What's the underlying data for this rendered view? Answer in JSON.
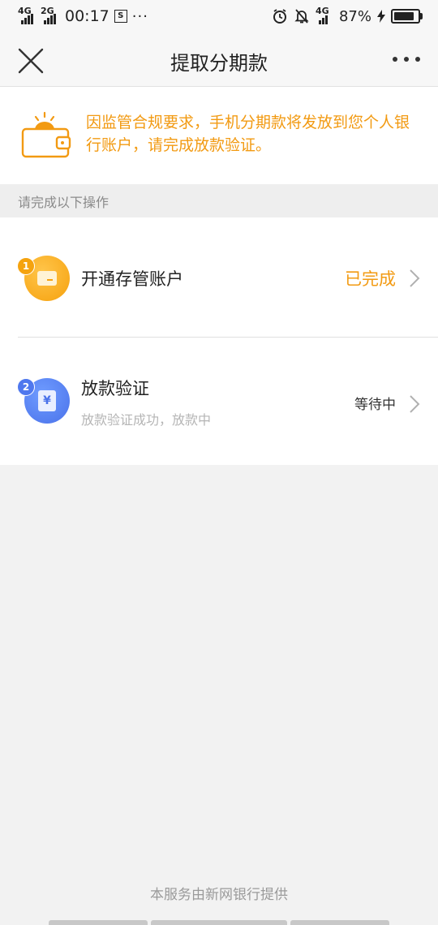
{
  "status_bar": {
    "net1": "4G",
    "net2": "2G",
    "time": "00:17",
    "s_icon_text": "S",
    "more": "···",
    "net3": "4G",
    "battery_pct": "87%",
    "battery_level": 0.87
  },
  "nav": {
    "title": "提取分期款"
  },
  "notice": {
    "text": "因监管合规要求，手机分期款将发放到您个人银行账户，请完成放款验证。"
  },
  "section": {
    "heading": "请完成以下操作"
  },
  "steps": [
    {
      "badge": "1",
      "title": "开通存管账户",
      "status": "已完成",
      "icon": "wallet-card-icon"
    },
    {
      "badge": "2",
      "title": "放款验证",
      "subtitle": "放款验证成功，放款中",
      "status": "等待中",
      "icon_glyph": "¥",
      "icon": "yen-document-icon"
    }
  ],
  "footer": {
    "text": "本服务由新网银行提供"
  },
  "colors": {
    "accent_orange": "#f29a12",
    "accent_blue": "#4a72ea"
  }
}
